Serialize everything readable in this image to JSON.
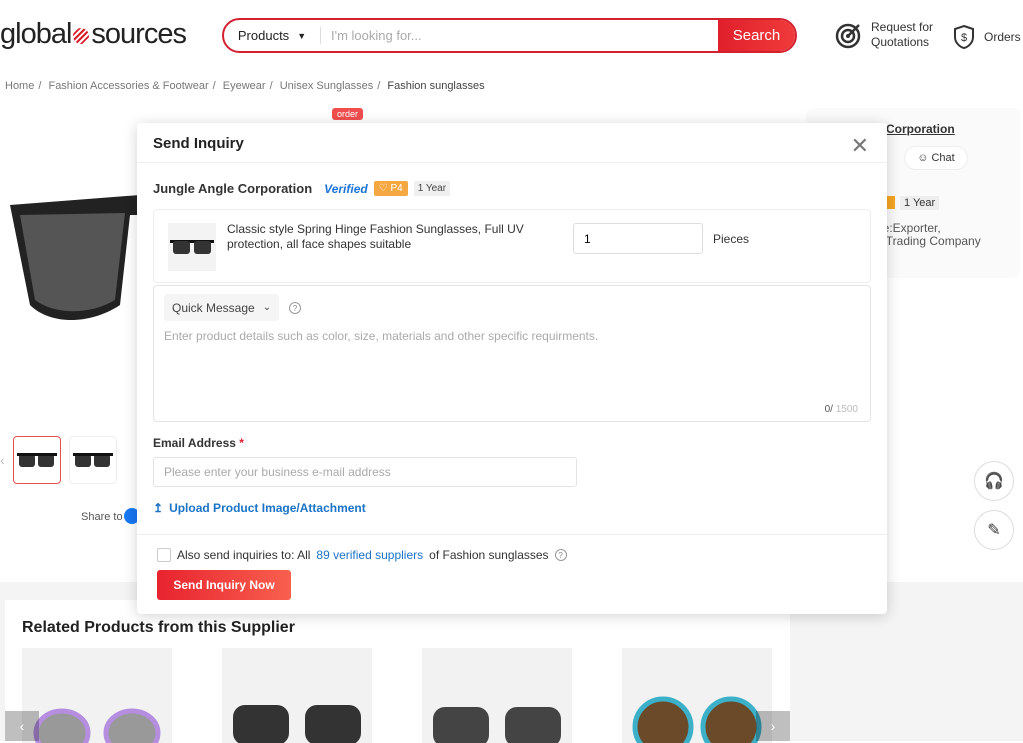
{
  "header": {
    "logo": "globalsources",
    "search_category": "Products",
    "search_placeholder": "I'm looking for...",
    "search_button": "Search",
    "rfq_line1": "Request for",
    "rfq_line2": "Quotations",
    "orders": "Orders"
  },
  "breadcrumb": [
    "Home",
    "Fashion Accessories & Footwear",
    "Eyewear",
    "Unisex Sunglasses",
    "Fashion sunglasses"
  ],
  "product_page": {
    "order_badge": "order",
    "share_label": "Share to"
  },
  "supplier_card": {
    "name": "e Corporation",
    "chat": "Chat",
    "years": "1 Year",
    "type_line1": "pe:Exporter,",
    "type_line2": "r, Trading Company"
  },
  "modal": {
    "title": "Send Inquiry",
    "supplier_name": "Jungle Angle Corporation",
    "verified": "Verified",
    "level": "P4",
    "years": "1 Year",
    "product_title": "Classic style Spring Hinge Fashion Sunglasses, Full UV protection, all face shapes suitable",
    "quantity": "1",
    "unit": "Pieces",
    "quick_message": "Quick Message",
    "message_placeholder": "Enter product details such as color, size, materials and other specific requirments.",
    "char_count": "0/",
    "char_max": "1500",
    "email_label": "Email Address",
    "email_required": "*",
    "email_placeholder": "Please enter your business e-mail address",
    "upload_label": "Upload Product Image/Attachment",
    "also_send_prefix": "Also send inquiries to: All",
    "also_send_link": "89 verified suppliers",
    "also_send_suffix": "of Fashion sunglasses",
    "submit": "Send Inquiry Now"
  },
  "related": {
    "title": "Related Products from this Supplier"
  },
  "colors": {
    "brand_red": "#e0202c",
    "link_blue": "#1a73c6",
    "verified_blue": "#1a73d6",
    "level_orange": "#f5a742"
  }
}
